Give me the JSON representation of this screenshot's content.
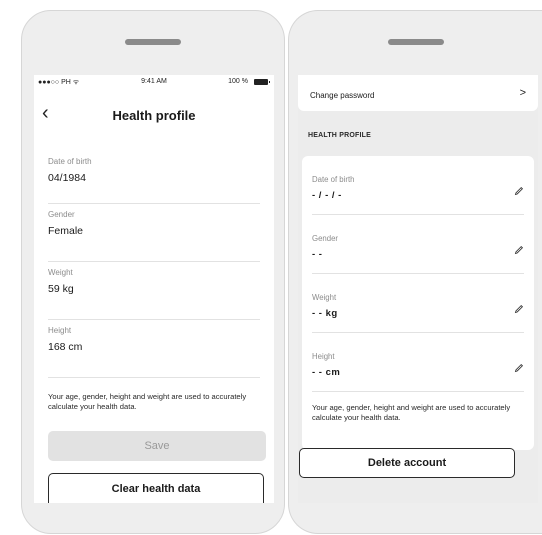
{
  "left": {
    "status": {
      "carrier": "●●●○○ PH ᯤ",
      "time": "9:41 AM",
      "battery_pct": "100 %"
    },
    "title": "Health profile",
    "back_icon": "chevron-left-icon",
    "fields": [
      {
        "label": "Date of birth",
        "value": "04/1984"
      },
      {
        "label": "Gender",
        "value": "Female"
      },
      {
        "label": "Weight",
        "value": "59 kg"
      },
      {
        "label": "Height",
        "value": "168 cm"
      }
    ],
    "note": "Your age, gender, height and weight are used to accurately calculate your health data.",
    "save_label": "Save",
    "clear_label": "Clear health data"
  },
  "right": {
    "change_password_label": "Change password",
    "chevron_icon": "chevron-right-icon",
    "section_title": "HEALTH PROFILE",
    "fields": [
      {
        "label": "Date of birth",
        "value": "- / - / -"
      },
      {
        "label": "Gender",
        "value": "- -"
      },
      {
        "label": "Weight",
        "value": "- - kg"
      },
      {
        "label": "Height",
        "value": "- - cm"
      }
    ],
    "edit_icon": "pencil-icon",
    "note": "Your age, gender, height and weight are used to accurately calculate your health data.",
    "delete_label": "Delete account"
  },
  "colors": {
    "accent_dark": "#2a2a2a",
    "muted_label": "#8c8c8c",
    "disabled_btn": "#e2e2e2"
  }
}
